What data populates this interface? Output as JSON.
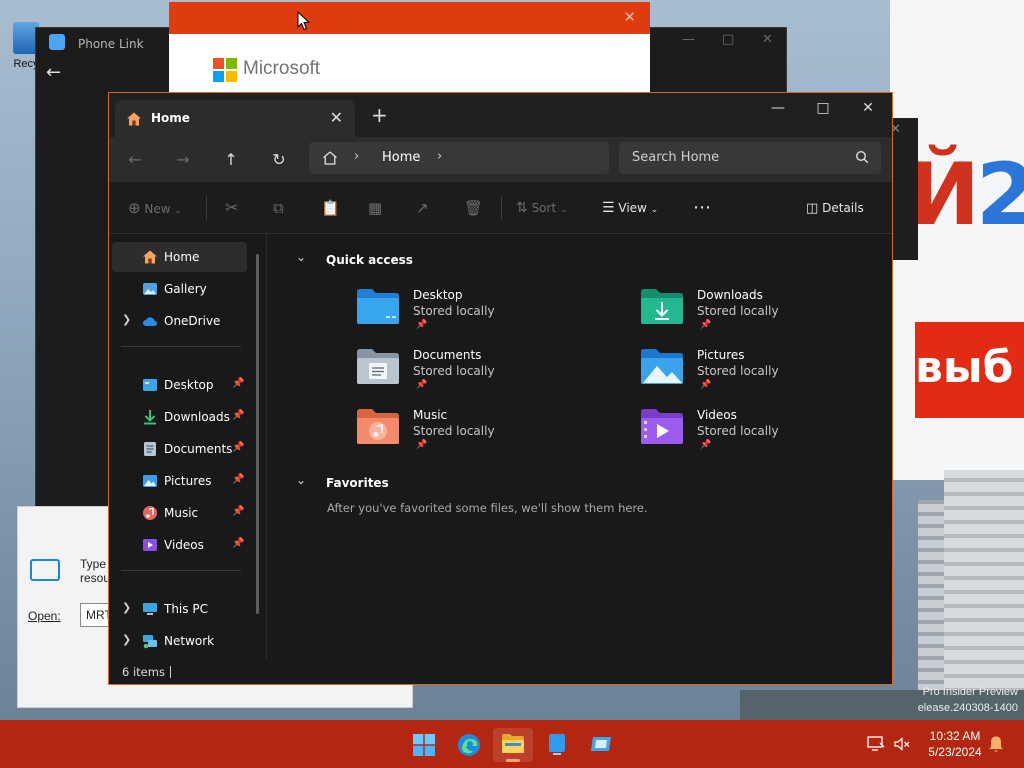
{
  "desktop": {
    "recycle_label": "Recy",
    "ad_headline_a": "Й",
    "ad_headline_b": "2",
    "ad_red_text": "выб",
    "watermark_line1": "Pro Insider Preview",
    "watermark_line2": "elease.240308-1400"
  },
  "phone_link": {
    "title": "Phone Link"
  },
  "ms_window": {
    "brand": "Microsoft",
    "logo_colors": [
      "#f25022",
      "#7fba00",
      "#00a4ef",
      "#ffb900"
    ]
  },
  "run_dialog": {
    "message": "Type resou",
    "open_label": "Open:",
    "open_value": "MRT"
  },
  "explorer": {
    "accent": "#d2691e",
    "tab_label": "Home",
    "breadcrumb": "Home",
    "search_placeholder": "Search Home",
    "toolbar": {
      "new": "New",
      "sort": "Sort",
      "view": "View",
      "details": "Details"
    },
    "nav": {
      "home": "Home",
      "gallery": "Gallery",
      "onedrive": "OneDrive",
      "desktop": "Desktop",
      "downloads": "Downloads",
      "documents": "Documents",
      "pictures": "Pictures",
      "music": "Music",
      "videos": "Videos",
      "this_pc": "This PC",
      "network": "Network"
    },
    "quick_access_title": "Quick access",
    "folders": [
      {
        "name": "Desktop",
        "status": "Stored locally",
        "icon": "desktop-folder-icon"
      },
      {
        "name": "Downloads",
        "status": "Stored locally",
        "icon": "downloads-folder-icon"
      },
      {
        "name": "Documents",
        "status": "Stored locally",
        "icon": "documents-folder-icon"
      },
      {
        "name": "Pictures",
        "status": "Stored locally",
        "icon": "pictures-folder-icon"
      },
      {
        "name": "Music",
        "status": "Stored locally",
        "icon": "music-folder-icon"
      },
      {
        "name": "Videos",
        "status": "Stored locally",
        "icon": "videos-folder-icon"
      }
    ],
    "favorites_title": "Favorites",
    "favorites_empty": "After you've favorited some files, we'll show them here.",
    "status_count": "6 items"
  },
  "taskbar": {
    "color": "#b32710",
    "time": "10:32 AM",
    "date": "5/23/2024"
  }
}
